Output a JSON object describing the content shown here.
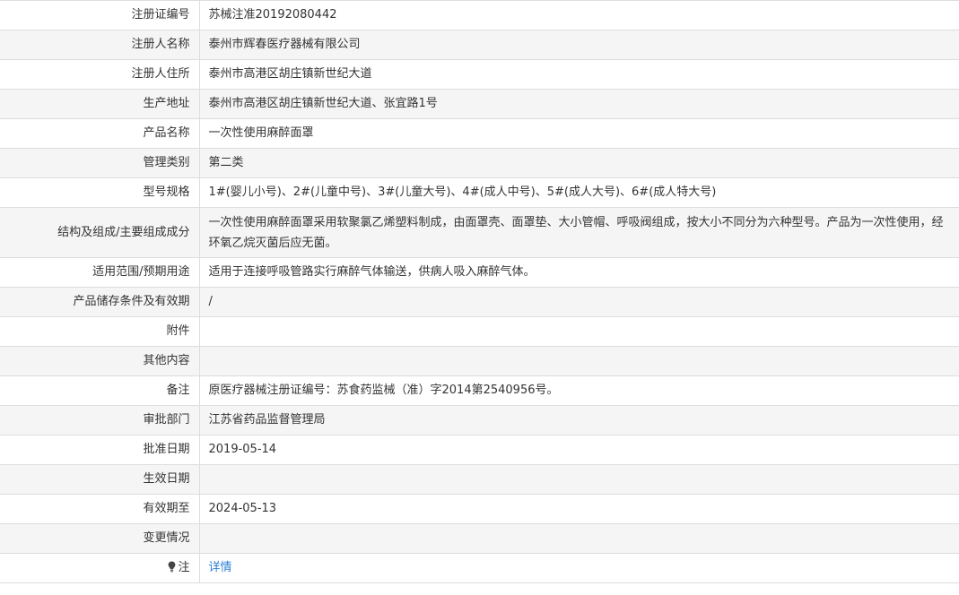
{
  "rows": [
    {
      "label": "注册证编号",
      "value": "苏械注准20192080442"
    },
    {
      "label": "注册人名称",
      "value": "泰州市辉春医疗器械有限公司"
    },
    {
      "label": "注册人住所",
      "value": "泰州市高港区胡庄镇新世纪大道"
    },
    {
      "label": "生产地址",
      "value": "泰州市高港区胡庄镇新世纪大道、张宜路1号"
    },
    {
      "label": "产品名称",
      "value": "一次性使用麻醉面罩"
    },
    {
      "label": "管理类别",
      "value": "第二类"
    },
    {
      "label": "型号规格",
      "value": "1#(婴儿小号)、2#(儿童中号)、3#(儿童大号)、4#(成人中号)、5#(成人大号)、6#(成人特大号)"
    },
    {
      "label": "结构及组成/主要组成成分",
      "value": "一次性使用麻醉面罩采用软聚氯乙烯塑料制成，由面罩壳、面罩垫、大小管帽、呼吸阀组成，按大小不同分为六种型号。产品为一次性使用，经环氧乙烷灭菌后应无菌。"
    },
    {
      "label": "适用范围/预期用途",
      "value": "适用于连接呼吸管路实行麻醉气体输送，供病人吸入麻醉气体。"
    },
    {
      "label": "产品储存条件及有效期",
      "value": "/"
    },
    {
      "label": "附件",
      "value": ""
    },
    {
      "label": "其他内容",
      "value": ""
    },
    {
      "label": "备注",
      "value": "原医疗器械注册证编号：苏食药监械（准）字2014第2540956号。"
    },
    {
      "label": "审批部门",
      "value": "江苏省药品监督管理局"
    },
    {
      "label": "批准日期",
      "value": "2019-05-14"
    },
    {
      "label": "生效日期",
      "value": ""
    },
    {
      "label": "有效期至",
      "value": "2024-05-13"
    },
    {
      "label": "变更情况",
      "value": ""
    }
  ],
  "note": {
    "icon": "lightbulb-icon",
    "label": "注",
    "link_text": "详情",
    "link_color": "#2a7fd4"
  }
}
